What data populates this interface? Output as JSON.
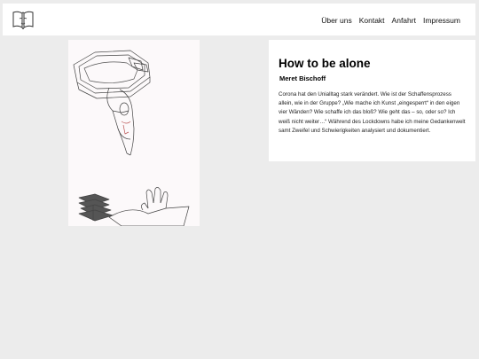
{
  "header": {
    "logo_icon": "book-face-logo-icon",
    "nav": [
      "Über uns",
      "Kontakt",
      "Anfahrt",
      "Impressum"
    ]
  },
  "artwork": {
    "description_icon": "line-drawing-illustration"
  },
  "article": {
    "title": "How to be alone",
    "author": "Meret Bischoff",
    "body": "Corona hat den Unialltag stark verändert. Wie ist der Schaffensprozess allein, wie in der Gruppe? „Wie mache ich Kunst „eingesperrt“ in den eigen vier Wänden? Wie schaffe ich das bloß? Wie geht das – so, oder so? Ich weiß nicht weiter…“ Während des Lockdowns habe ich meine Gedankenwelt samt Zweifel und Schwierigkeiten analysiert und dokumentiert."
  },
  "colors": {
    "page_bg": "#ececec",
    "card_bg": "#ffffff",
    "text": "#111111"
  }
}
